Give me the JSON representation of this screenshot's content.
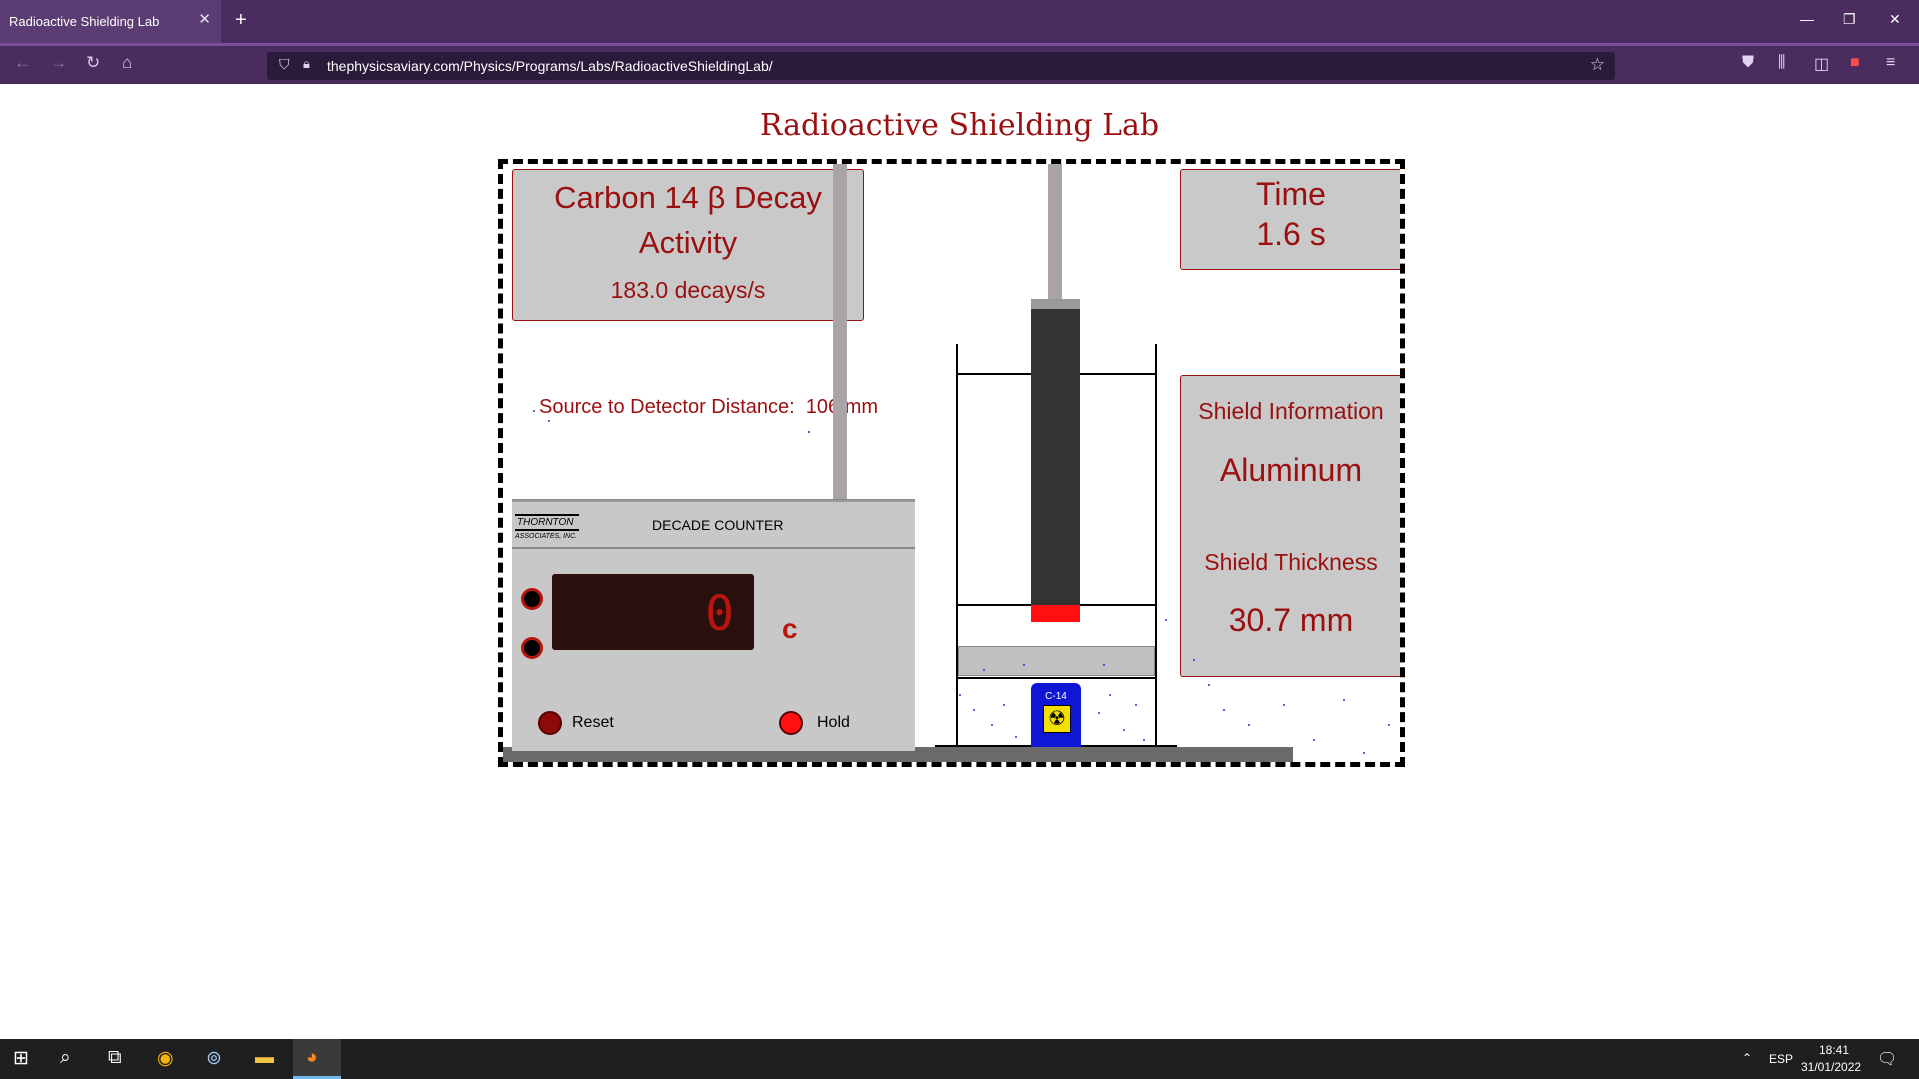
{
  "browser": {
    "tab_title": "Radioactive Shielding Lab",
    "tab_close": "✕",
    "new_tab": "+",
    "url": "thephysicsaviary.com/Physics/Programs/Labs/RadioactiveShieldingLab/",
    "icons": [
      "back-icon",
      "forward-icon",
      "reload-icon",
      "home-icon",
      "shield-icon",
      "lock-icon",
      "bookmark-star-icon",
      "pocket-icon",
      "library-icon",
      "sidebar-icon",
      "extension-icon",
      "menu-icon"
    ]
  },
  "page": {
    "title": "Radioactive Shielding Lab"
  },
  "lab": {
    "decay_title_line1": "Carbon 14 β Decay",
    "decay_title_line2": "Activity",
    "activity": "183.0 decays/s",
    "time_label": "Time",
    "time_value": "1.6 s",
    "distance_label": "Source to Detector Distance:  106 mm",
    "shield_info_label": "Shield Information",
    "shield_material": "Aluminum",
    "shield_thickness_label": "Shield Thickness",
    "shield_thickness": "30.7 mm",
    "counter": {
      "brand_line1": "THORNTON",
      "brand_line2": "ASSOCIATES, INC.",
      "title": "DECADE COUNTER",
      "count": "0",
      "reset_label": "Reset",
      "hold_label": "Hold"
    },
    "source_label": "C-14",
    "colors": {
      "accent": "#9a0f0f",
      "panel": "#c9c9c9",
      "source": "#1016d6",
      "detector_tip": "#ff0f0f"
    }
  },
  "taskbar": {
    "language": "ESP",
    "time": "18:41",
    "date": "31/01/2022",
    "apps": [
      "windows-start-icon",
      "search-icon",
      "task-view-icon",
      "chrome-icon",
      "steam-icon",
      "file-explorer-icon",
      "firefox-icon"
    ]
  }
}
